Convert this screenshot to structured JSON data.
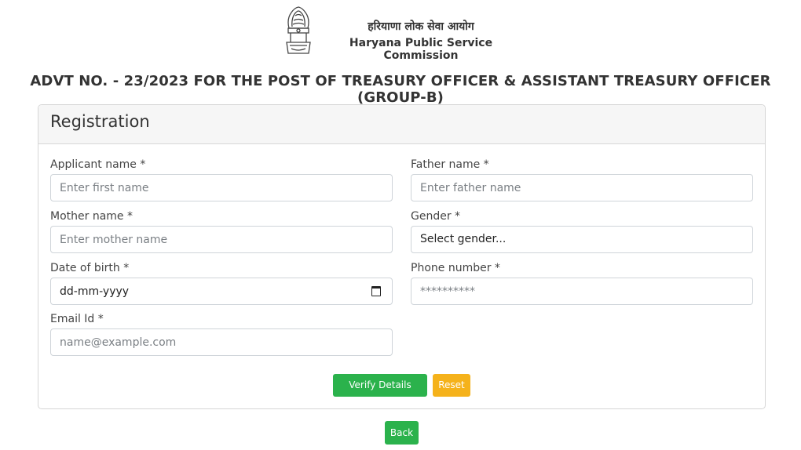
{
  "header": {
    "org_name_hindi": "हरियाणा लोक सेवा आयोग",
    "org_name_english": "Haryana Public Service Commission",
    "emblem_icon": "national-emblem-icon"
  },
  "advertisement_title": "ADVT NO. - 23/2023 FOR THE POST OF TREASURY OFFICER & ASSISTANT TREASURY OFFICER (GROUP-B)",
  "form": {
    "title": "Registration",
    "applicant_name": {
      "label": "Applicant name *",
      "placeholder": "Enter first name",
      "value": ""
    },
    "father_name": {
      "label": "Father name *",
      "placeholder": "Enter father name",
      "value": ""
    },
    "mother_name": {
      "label": "Mother name *",
      "placeholder": "Enter mother name",
      "value": ""
    },
    "gender": {
      "label": "Gender *",
      "selected": "Select gender..."
    },
    "date_of_birth": {
      "label": "Date of birth *",
      "value": "dd-mm-yyyy",
      "icon": "calendar-icon"
    },
    "phone_number": {
      "label": "Phone number *",
      "placeholder": "**********",
      "value": ""
    },
    "email": {
      "label": "Email Id *",
      "placeholder": "name@example.com",
      "value": ""
    },
    "buttons": {
      "verify_label": "Verify Details",
      "reset_label": "Reset"
    }
  },
  "back_button_label": "Back",
  "colors": {
    "success": "#2bb24c",
    "warning": "#f5b21b",
    "card_header_bg": "#f6f6f6",
    "border": "#d6d6d6"
  }
}
